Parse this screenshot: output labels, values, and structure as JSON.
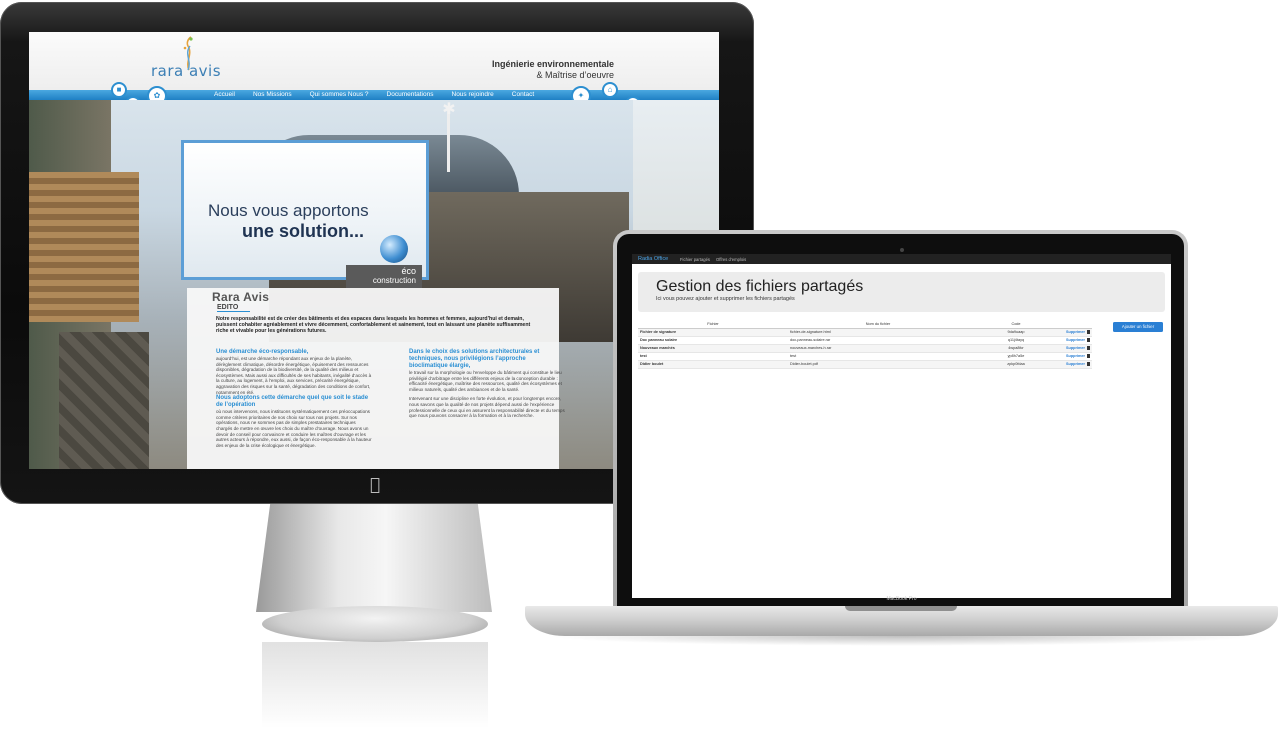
{
  "imac_site": {
    "logo": "rara avis",
    "tagline_line1": "Ingénierie environnementale",
    "tagline_line2": "& Maîtrise d’oeuvre",
    "nav": [
      "Accueil",
      "Nos Missions",
      "Qui sommes Nous ?",
      "Documentations",
      "Nous rejoindre",
      "Contact"
    ],
    "slogan_line1": "Nous vous apportons",
    "slogan_line2": "une solution...",
    "badge_line1": "éco",
    "badge_line2": "construction",
    "section_title": "Rara Avis",
    "section_sub": "EDITO",
    "intro": "Notre responsabilité est de créer des bâtiments et des espaces dans lesquels les hommes et femmes, aujourd’hui et demain, puissent cohabiter agréablement et vivre décemment, confortablement et sainement, tout en laissant une planète suffisamment riche et vivable pour les générations futures.",
    "left_heading_1": "Une démarche éco-responsable,",
    "left_text_1": "aujourd’hui, est une démarche répondant aux enjeux de la planète, dérèglement climatique, désordre énergétique, épuisement des ressources disponibles, dégradation de la biodiversité, de la qualité des milieux et écosystèmes. Mais aussi aux difficultés de ses habitants, inégalité d’accès à la culture, au logement, à l’emploi, aux services, précarité énergétique, aggravation des risques sur la santé, dégradation des conditions de confort, notamment en été.",
    "left_heading_2": "Nous adoptons cette démarche quel que soit le stade de l’opération",
    "left_text_2": "où nous intervenons, nous instituons systématiquement ces préoccupations comme critères prioritaires de nos choix sur tous nos projets. Sur nos opérations, nous ne sommes pas de simples prestataires techniques chargés de mettre en œuvre les choix du maître d’ouvrage. Nous avons un devoir de conseil pour convaincre et conduire les maîtres d’ouvrage et les autres acteurs à répondre, eux aussi, de façon éco-responsable à la hauteur des enjeux de la crise écologique et énergétique.",
    "right_heading_1": "Dans le choix des solutions architecturales et techniques, nous privilégions l’approche bioclimatique élargie,",
    "right_text_1": "le travail sur la morphologie ou l’enveloppe du bâtiment qui constitue le lieu privilégié d’arbitrage entre les différents enjeux de la conception durable : efficacité énergétique, maîtrise des ressources, qualité des écosystèmes et milieux naturels, qualité des ambiances et de la santé.",
    "right_text_2": "Intervenant sur une discipline en forte évolution, et pour longtemps encore, nous savons que la qualité de nos projets dépend aussi de l’expérience professionnelle de ceux qui en assurent la responsabilité directe et du temps que nous pouvons consacrer à la formation et à la recherche."
  },
  "macbook_app": {
    "brand": "Radia Office",
    "nav_links": [
      "Fichier partagés",
      "Offres d’emplois"
    ],
    "title": "Gestion des fichiers partagés",
    "subtitle": "Ici vous pouvez ajouter et supprimer les fichiers partagés",
    "table_headers": [
      "Fichier",
      "Nom du fichier",
      "Code",
      ""
    ],
    "rows": [
      {
        "name": "Fichier de signature",
        "file": "fichier-de-signature.html",
        "code": "9da9uaap",
        "action": "Supprimer"
      },
      {
        "name": "Doc panneau solaire",
        "file": "doc-panneau-solaire.rar",
        "code": "q11j4tayq",
        "action": "Supprimer"
      },
      {
        "name": "Nouveaux marchés",
        "file": "nouveaux-marches-h.rar",
        "code": "4wpa8fcr",
        "action": "Supprimer"
      },
      {
        "name": "test",
        "file": "test",
        "code": "yp8h7a5e",
        "action": "Supprimer"
      },
      {
        "name": "Didier boulet",
        "file": "Didier-boulet.pdf",
        "code": "zpkp0fdaa",
        "action": "Supprimer"
      }
    ],
    "add_button": "Ajouter un fichier",
    "laptop_label": "MacBook Pro"
  },
  "colors": {
    "accent_blue": "#2a7fd4",
    "nav_blue": "#1f80c4"
  }
}
